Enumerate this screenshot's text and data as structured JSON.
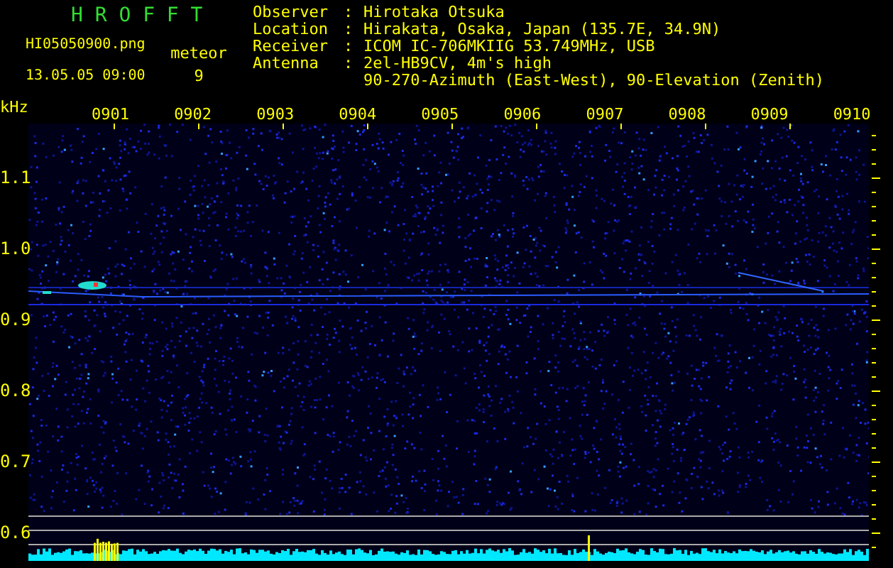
{
  "header": {
    "title": "H R O F F T",
    "filename": "HI05050900.png",
    "datetime": "13.05.05 09:00",
    "count_label": "meteor",
    "count": "9"
  },
  "info": [
    {
      "label": "Observer",
      "separator": ":",
      "lines": [
        "Hirotaka Otsuka"
      ]
    },
    {
      "label": "Location",
      "separator": ":",
      "lines": [
        "Hirakata, Osaka, Japan (135.7E, 34.9N)"
      ]
    },
    {
      "label": "Receiver",
      "separator": ":",
      "lines": [
        "ICOM IC-706MKIIG 53.749MHz, USB"
      ]
    },
    {
      "label": "Antenna",
      "separator": ":",
      "lines": [
        "2el-HB9CV, 4m's high",
        "90-270-Azimuth (East-West), 90-Elevation (Zenith)"
      ]
    }
  ],
  "frequency_axis": {
    "unit": "kHz",
    "labels": [
      "1.1",
      "1.0",
      "0.9",
      "0.8",
      "0.7",
      "0.6"
    ]
  },
  "time_axis": {
    "labels": [
      "0901",
      "0902",
      "0903",
      "0904",
      "0905",
      "0906",
      "0907",
      "0908",
      "0909",
      "0910"
    ]
  }
}
